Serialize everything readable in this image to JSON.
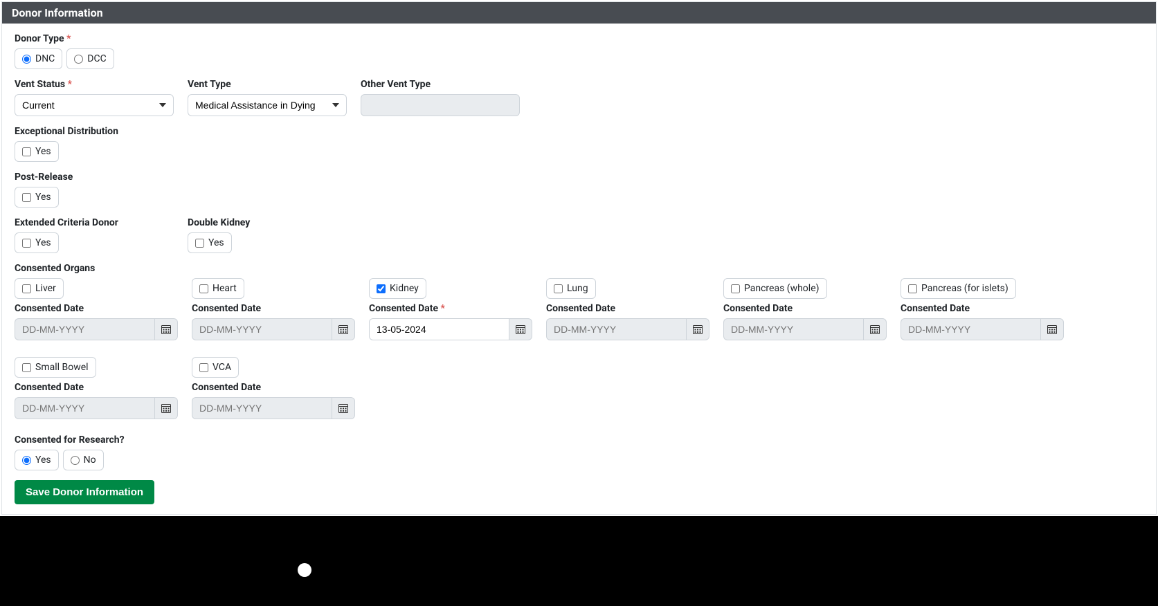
{
  "header": {
    "title": "Donor Information"
  },
  "donorType": {
    "label": "Donor Type",
    "options": [
      {
        "label": "DNC",
        "checked": true
      },
      {
        "label": "DCC",
        "checked": false
      }
    ]
  },
  "ventStatus": {
    "label": "Vent Status",
    "value": "Current",
    "options": [
      "Current"
    ]
  },
  "ventType": {
    "label": "Vent Type",
    "value": "Medical Assistance in Dying",
    "options": [
      "Medical Assistance in Dying"
    ]
  },
  "otherVentType": {
    "label": "Other Vent Type",
    "value": ""
  },
  "exceptionalDistribution": {
    "label": "Exceptional Distribution",
    "option": "Yes",
    "checked": false
  },
  "postRelease": {
    "label": "Post-Release",
    "option": "Yes",
    "checked": false
  },
  "extendedCriteria": {
    "label": "Extended Criteria Donor",
    "option": "Yes",
    "checked": false
  },
  "doubleKidney": {
    "label": "Double Kidney",
    "option": "Yes",
    "checked": false
  },
  "consentedOrgans": {
    "label": "Consented Organs",
    "consentedDateLabel": "Consented Date",
    "datePlaceholder": "DD-MM-YYYY",
    "items": [
      {
        "label": "Liver",
        "checked": false,
        "date": "",
        "required": false
      },
      {
        "label": "Heart",
        "checked": false,
        "date": "",
        "required": false
      },
      {
        "label": "Kidney",
        "checked": true,
        "date": "13-05-2024",
        "required": true
      },
      {
        "label": "Lung",
        "checked": false,
        "date": "",
        "required": false
      },
      {
        "label": "Pancreas (whole)",
        "checked": false,
        "date": "",
        "required": false
      },
      {
        "label": "Pancreas (for islets)",
        "checked": false,
        "date": "",
        "required": false
      },
      {
        "label": "Small Bowel",
        "checked": false,
        "date": "",
        "required": false
      },
      {
        "label": "VCA",
        "checked": false,
        "date": "",
        "required": false
      }
    ]
  },
  "consentedResearch": {
    "label": "Consented for Research?",
    "options": [
      {
        "label": "Yes",
        "checked": true
      },
      {
        "label": "No",
        "checked": false
      }
    ]
  },
  "save": {
    "label": "Save Donor Information"
  }
}
